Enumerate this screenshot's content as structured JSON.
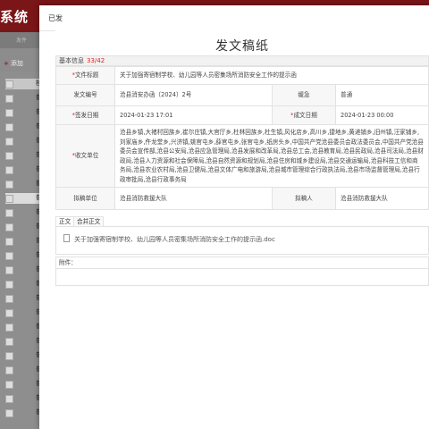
{
  "background_app": {
    "title": "系统",
    "subnav_label": "发件",
    "add_button": "添加",
    "row_labels": [
      "核",
      "普",
      "普",
      "普",
      "普",
      "普",
      "普",
      "普",
      "普",
      "普",
      "普",
      "普",
      "普",
      "普",
      "普",
      "普",
      "普",
      "普",
      "普",
      "普",
      "普",
      "普",
      "普",
      "普"
    ]
  },
  "dialog": {
    "title": "已发",
    "doc_heading": "发文稿纸",
    "section": {
      "label": "基本信息",
      "count": "33/42"
    },
    "fields": {
      "subject": {
        "label": "文件标题",
        "value": "关于加强寄宿制学校、幼儿园等人员密集场所消防安全工作的提示函"
      },
      "doc_number": {
        "label": "发文编号",
        "value": "沧县消安办函〔2024〕2号"
      },
      "urgency": {
        "label": "缓急",
        "value": "普通"
      },
      "issue_date": {
        "label": "签发日期",
        "value": "2024-01-23 17:01"
      },
      "complete_date": {
        "label": "成文日期",
        "value": "2024-01-23 00:00"
      },
      "receivers": {
        "label": "收文单位",
        "value": "沧县乡镇,大褚村回族乡,崔尔庄镇,大官厅乡,杜林回族乡,杜生镇,风化店乡,高川乡,捷地乡,黄递铺乡,旧州镇,汪家铺乡,刘家庙乡,仵龙堂乡,兴济镇,姚官屯乡,薛官屯乡,张官屯乡,纸房头乡,中国共产党沧县委员会政法委员会,中国共产党沧县委员会宣传部,沧县公安局,沧县应急管理局,沧县发展和改革局,沧县总工会,沧县教育局,沧县民政局,沧县司法局,沧县财政局,沧县人力资源和社会保障局,沧县自然资源和规划局,沧县住房和城乡建设局,沧县交通运输局,沧县科技工信和商务局,沧县农业农村局,沧县卫健局,沧县文体广电和旅游局,沧县城市管理综合行政执法局,沧县市场监督管理局,沧县行政审批局,沧县行政事务局"
      },
      "draft_unit": {
        "label": "拟稿单位",
        "value": "沧县消防救援大队"
      },
      "drafter": {
        "label": "拟稿人",
        "value": "沧县消防救援大队"
      }
    },
    "tabs": [
      "正文",
      "合并正文"
    ],
    "body_file": "关于加强寄宿制学校、幼儿园等人员密集场所消防安全工作的提示函.doc",
    "attachments_label": "附件："
  }
}
